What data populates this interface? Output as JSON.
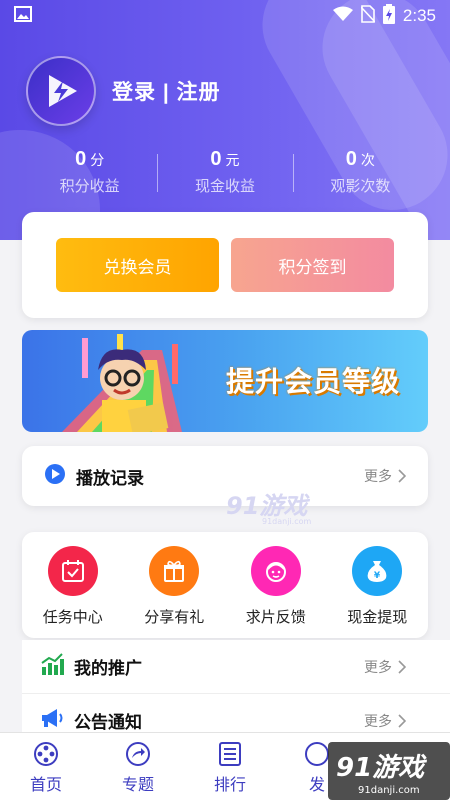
{
  "status_bar": {
    "time": "2:35"
  },
  "profile": {
    "login_label": "登录 | 注册"
  },
  "stats": [
    {
      "value": "0",
      "unit": "分",
      "label": "积分收益"
    },
    {
      "value": "0",
      "unit": "元",
      "label": "现金收益"
    },
    {
      "value": "0",
      "unit": "次",
      "label": "观影次数"
    }
  ],
  "actions": {
    "exchange_label": "兑换会员",
    "checkin_label": "积分签到"
  },
  "banner": {
    "text": "提升会员等级"
  },
  "history": {
    "title": "播放记录",
    "more": "更多"
  },
  "grid": [
    {
      "label": "任务中心",
      "icon": "calendar-check-icon",
      "color": "#f3264a"
    },
    {
      "label": "分享有礼",
      "icon": "gift-icon",
      "color": "#ff7a12"
    },
    {
      "label": "求片反馈",
      "icon": "face-icon",
      "color": "#ff28b4"
    },
    {
      "label": "现金提现",
      "icon": "money-bag-icon",
      "color": "#1ea7f5"
    }
  ],
  "list": [
    {
      "title": "我的推广",
      "more": "更多",
      "icon": "chart-icon"
    },
    {
      "title": "公告通知",
      "more": "更多",
      "icon": "megaphone-icon"
    }
  ],
  "tabs": [
    {
      "label": "首页",
      "icon": "film-reel-icon"
    },
    {
      "label": "专题",
      "icon": "share-icon"
    },
    {
      "label": "排行",
      "icon": "list-icon"
    },
    {
      "label": "发",
      "icon": "discover-icon"
    }
  ],
  "watermark": {
    "brand": "91游戏",
    "site": "91danji.com"
  },
  "colors": {
    "header": "#6254ea",
    "accent": "#3d3dc0",
    "exchange": "#ffb000",
    "checkin": "#f59a98"
  }
}
